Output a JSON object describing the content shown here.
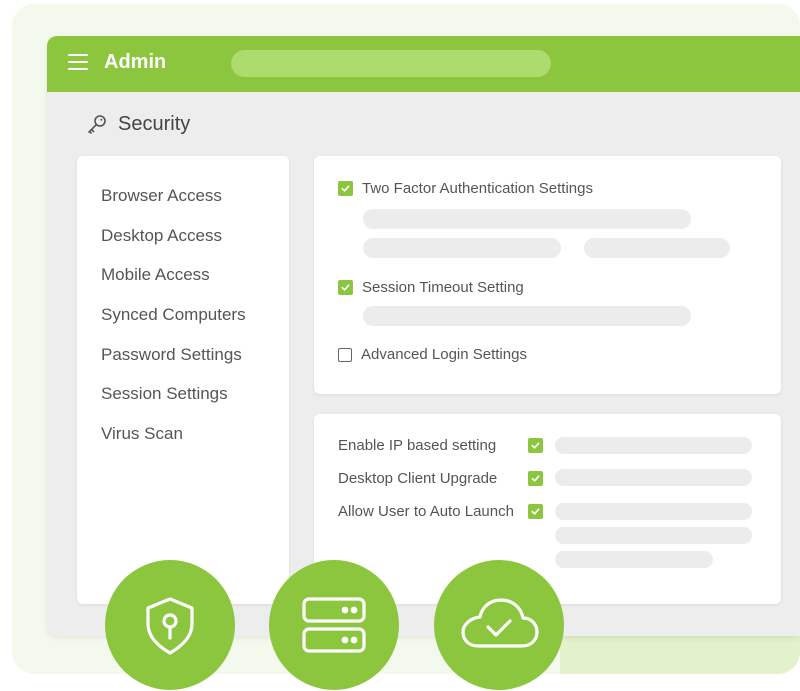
{
  "header": {
    "title": "Admin"
  },
  "page": {
    "title": "Security"
  },
  "sidebar": {
    "items": [
      {
        "label": "Browser Access"
      },
      {
        "label": "Desktop Access"
      },
      {
        "label": "Mobile Access"
      },
      {
        "label": "Synced Computers"
      },
      {
        "label": "Password Settings"
      },
      {
        "label": "Session Settings"
      },
      {
        "label": "Virus Scan"
      }
    ]
  },
  "auth_settings": [
    {
      "label": "Two Factor Authentication Settings",
      "checked": true
    },
    {
      "label": "Session Timeout Setting",
      "checked": true
    },
    {
      "label": "Advanced Login Settings",
      "checked": false
    }
  ],
  "options": [
    {
      "label": "Enable IP based setting",
      "checked": true
    },
    {
      "label": "Desktop Client Upgrade",
      "checked": true
    },
    {
      "label": "Allow User to Auto Launch",
      "checked": true
    }
  ],
  "feature_icons": [
    "shield-lock-icon",
    "server-icon",
    "cloud-check-icon"
  ],
  "colors": {
    "accent": "#8cc63f",
    "search": "#addb6e",
    "placeholder": "#ececec"
  }
}
